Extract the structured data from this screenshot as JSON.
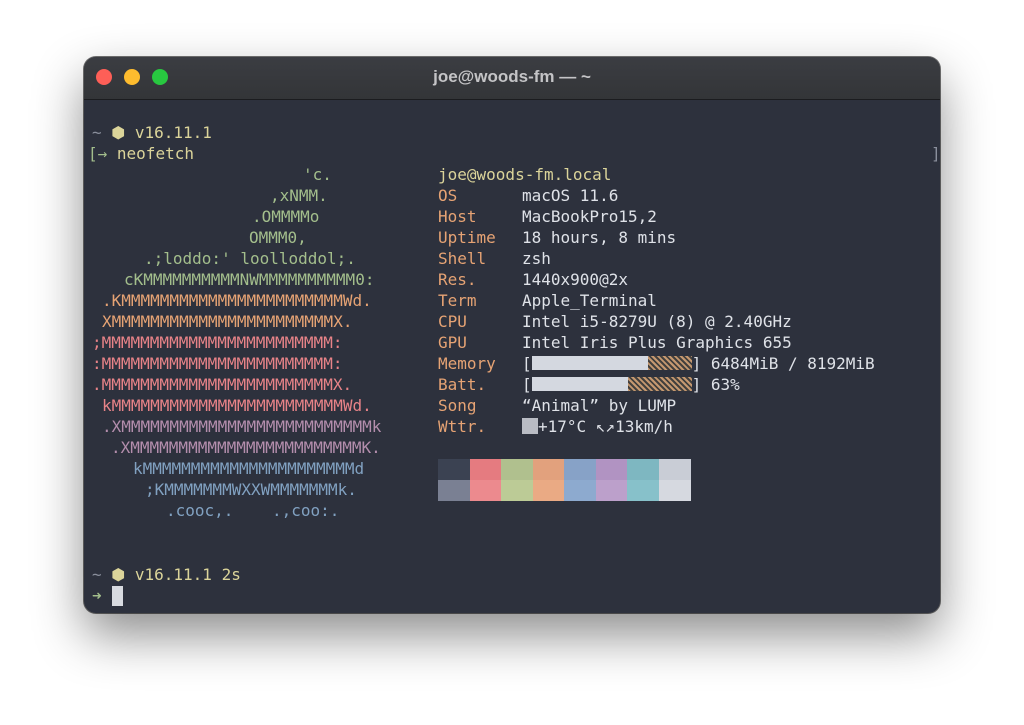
{
  "window": {
    "title": "joe@woods-fm — ~"
  },
  "prompt1": {
    "tilde": "~",
    "node_icon": "node-hexagon-icon",
    "version": "v16.11.1"
  },
  "command_line": {
    "arrow": "[→",
    "command": "neofetch",
    "bracket_right": "]"
  },
  "logo": [
    {
      "text": "'c.",
      "color": "#a3be8c"
    },
    {
      "text": ",xNMM.",
      "color": "#a3be8c"
    },
    {
      "text": ".OMMMMo",
      "color": "#a3be8c"
    },
    {
      "text": "OMMM0,",
      "color": "#a3be8c"
    },
    {
      "text": ".;loddo:' loolloddol;.",
      "color": "#a3be8c"
    },
    {
      "text": "cKMMMMMMMMMMNWMMMMMMMMMM0:",
      "color": "#a3be8c"
    },
    {
      "text": ".KMMMMMMMMMMMMMMMMMMMMMMMWd.",
      "color": "#e6a374"
    },
    {
      "text": "XMMMMMMMMMMMMMMMMMMMMMMMX.",
      "color": "#e6a374"
    },
    {
      "text": ";MMMMMMMMMMMMMMMMMMMMMMMM:",
      "color": "#e88388"
    },
    {
      "text": ":MMMMMMMMMMMMMMMMMMMMMMMM:",
      "color": "#e88388"
    },
    {
      "text": ".MMMMMMMMMMMMMMMMMMMMMMMMX.",
      "color": "#e88388"
    },
    {
      "text": "kMMMMMMMMMMMMMMMMMMMMMMMMWd.",
      "color": "#e88388"
    },
    {
      "text": ".XMMMMMMMMMMMMMMMMMMMMMMMMMMk",
      "color": "#b48ead"
    },
    {
      "text": ".XMMMMMMMMMMMMMMMMMMMMMMMMK.",
      "color": "#b48ead"
    },
    {
      "text": "kMMMMMMMMMMMMMMMMMMMMMMd",
      "color": "#81a1c1"
    },
    {
      "text": ";KMMMMMMMWXXWMMMMMMMk.",
      "color": "#81a1c1"
    },
    {
      "text": ".cooc,.    .,coo:.",
      "color": "#81a1c1"
    }
  ],
  "info": {
    "userhost": "joe@woods-fm.local",
    "rows": [
      {
        "key": "OS",
        "value": "macOS 11.6"
      },
      {
        "key": "Host",
        "value": "MacBookPro15,2"
      },
      {
        "key": "Uptime",
        "value": "18 hours, 8 mins"
      },
      {
        "key": "Shell",
        "value": "zsh"
      },
      {
        "key": "Res.",
        "value": "1440x900@2x"
      },
      {
        "key": "Term",
        "value": "Apple_Terminal"
      },
      {
        "key": "CPU",
        "value": "Intel i5-8279U (8) @ 2.40GHz"
      },
      {
        "key": "GPU",
        "value": "Intel Iris Plus Graphics 655"
      }
    ],
    "memory": {
      "key": "Memory",
      "bracket_open": "[",
      "bracket_close": "]",
      "value": "6484MiB / 8192MiB",
      "fill_fraction": 0.73
    },
    "battery": {
      "key": "Batt.",
      "bracket_open": "[",
      "bracket_close": "]",
      "value": "63%",
      "fill_fraction": 0.6
    },
    "song": {
      "key": "Song",
      "value": "“Animal” by LUMP"
    },
    "weather": {
      "key": "Wttr.",
      "icon": "weather-icon",
      "value": "+17°C ↖↗13km/h"
    }
  },
  "palette": {
    "top": [
      "#3b4252",
      "#e57b80",
      "#b0c08e",
      "#e2a17d",
      "#87a2c7",
      "#b193c2",
      "#7eb7c1",
      "#c9cdd6"
    ],
    "bottom": [
      "#7a8093",
      "#ec8a8e",
      "#bccb96",
      "#eaaa84",
      "#8daacf",
      "#bca0cb",
      "#87c1ca",
      "#d6d9e0"
    ]
  },
  "prompt2": {
    "tilde": "~",
    "node_icon": "node-hexagon-icon",
    "version": "v16.11.1",
    "duration": "2s"
  },
  "prompt3": {
    "arrow": "➜"
  },
  "colors": {
    "key": "#e6a374",
    "userhost": "#dbd49a",
    "text": "#dfe2e8",
    "prompt": "#a3be8c",
    "dim": "#8a8f9c"
  }
}
